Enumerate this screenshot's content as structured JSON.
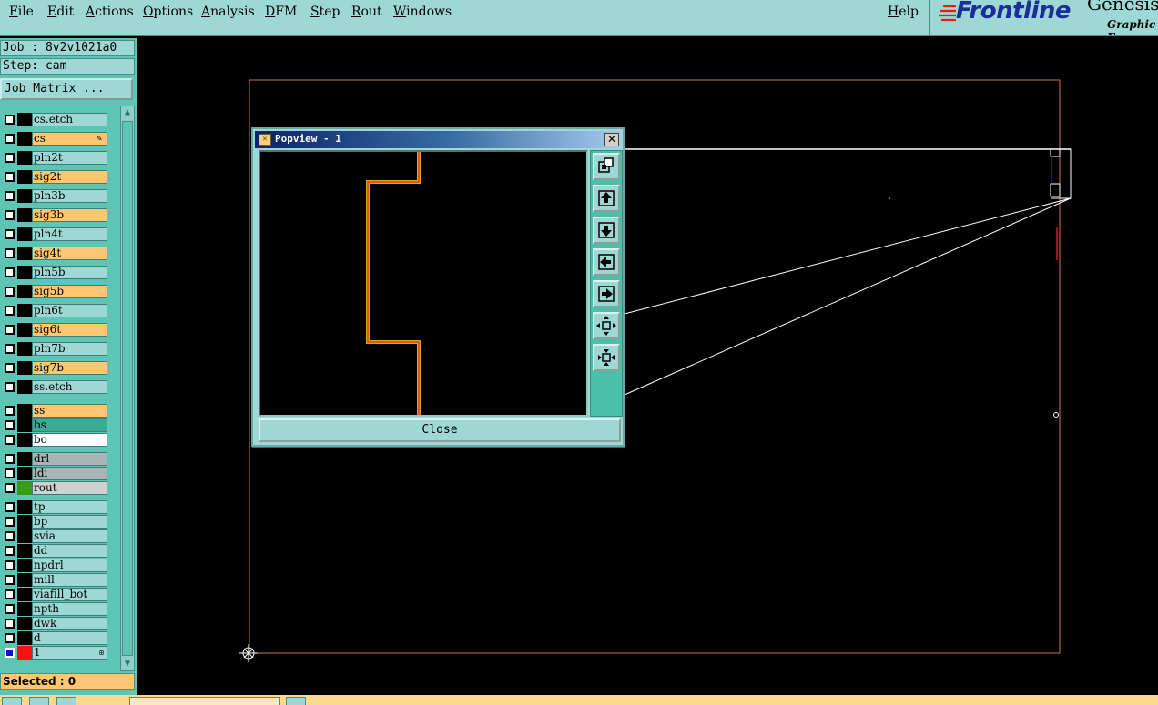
{
  "menubar": {
    "menus": [
      {
        "label": "File"
      },
      {
        "label": "Edit"
      },
      {
        "label": "Actions"
      },
      {
        "label": "Options"
      },
      {
        "label": "Analysis"
      },
      {
        "label": "DFM"
      },
      {
        "label": "Step"
      },
      {
        "label": "Rout"
      },
      {
        "label": "Windows"
      }
    ],
    "help": "Help"
  },
  "logo": {
    "brand": "Frontline",
    "product": "Genesis",
    "subtitle": "Graphic E"
  },
  "panel": {
    "job": "Job : 8v2v1021a0",
    "step": "Step: cam",
    "job_matrix": "Job Matrix ...",
    "selected": "Selected : 0"
  },
  "layers": [
    {
      "name": "cs.etch",
      "color": "teal"
    },
    {
      "name": "cs",
      "color": "orange",
      "active": true
    },
    {
      "name": "pln2t",
      "color": "teal"
    },
    {
      "name": "sig2t",
      "color": "orange"
    },
    {
      "name": "pln3b",
      "color": "teal"
    },
    {
      "name": "sig3b",
      "color": "orange"
    },
    {
      "name": "pln4t",
      "color": "teal"
    },
    {
      "name": "sig4t",
      "color": "orange"
    },
    {
      "name": "pln5b",
      "color": "teal"
    },
    {
      "name": "sig5b",
      "color": "orange"
    },
    {
      "name": "pln6t",
      "color": "teal"
    },
    {
      "name": "sig6t",
      "color": "orange"
    },
    {
      "name": "pln7b",
      "color": "teal"
    },
    {
      "name": "sig7b",
      "color": "orange"
    },
    {
      "name": "ss.etch",
      "color": "teal"
    },
    {
      "name": "ss",
      "color": "orange"
    },
    {
      "name": "bs",
      "color": "green"
    },
    {
      "name": "bo",
      "color": "white"
    },
    {
      "name": "drl",
      "color": "grey"
    },
    {
      "name": "ldi",
      "color": "grey"
    },
    {
      "name": "rout",
      "color": "lgrey",
      "swatch": "#3a9a1a"
    },
    {
      "name": "tp",
      "color": "teal"
    },
    {
      "name": "bp",
      "color": "teal"
    },
    {
      "name": "svia",
      "color": "teal"
    },
    {
      "name": "dd",
      "color": "teal"
    },
    {
      "name": "npdrl",
      "color": "teal"
    },
    {
      "name": "mill",
      "color": "teal"
    },
    {
      "name": "viafill_bot",
      "color": "teal"
    },
    {
      "name": "npth",
      "color": "teal"
    },
    {
      "name": "dwk",
      "color": "teal"
    },
    {
      "name": "d",
      "color": "teal"
    },
    {
      "name": "1",
      "color": "teal",
      "swatch": "#ff1010",
      "checked": true
    }
  ],
  "popview": {
    "title": "Popview - 1",
    "close": "Close",
    "tools": [
      "zoom-home-icon",
      "pan-up-icon",
      "pan-down-icon",
      "pan-left-icon",
      "pan-right-icon",
      "zoom-in-icon",
      "zoom-out-icon"
    ]
  },
  "colors": {
    "panel_bg": "#5ec4b4",
    "menu_bg": "#9ed8d4",
    "layer_orange": "#ffc870",
    "trace": "#d0a020",
    "trace_core": "#e03010",
    "profile": "#c87840"
  }
}
